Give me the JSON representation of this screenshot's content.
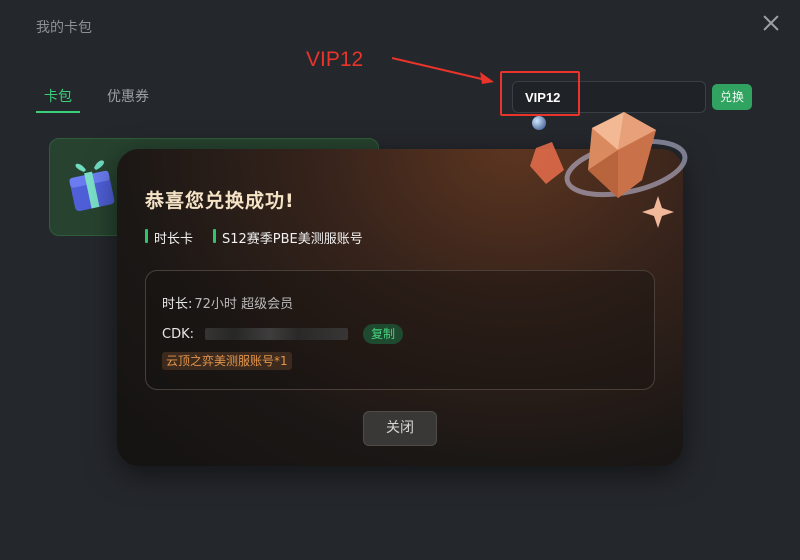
{
  "window": {
    "title": "我的卡包"
  },
  "annotation": {
    "label": "VIP12"
  },
  "tabs": [
    {
      "label": "卡包",
      "active": true
    },
    {
      "label": "优惠券",
      "active": false
    }
  ],
  "redeem": {
    "code_value": "VIP12",
    "button_label": "兑换"
  },
  "dialog": {
    "title": "恭喜您兑换成功!",
    "tags": [
      "时长卡",
      "S12赛季PBE美测服账号"
    ],
    "duration": {
      "label": "时长:",
      "value": "72小时 超级会员"
    },
    "cdk": {
      "label": "CDK:",
      "copy_label": "复制"
    },
    "reward_badge": "云顶之弈美测服账号*1",
    "close_label": "关闭"
  },
  "colors": {
    "accent_green": "#3ccf7a",
    "annotation_red": "#e8342a",
    "title_gold": "#f5e3c6",
    "badge_orange": "#e3954b"
  },
  "icons": [
    "close-icon",
    "gift-icon",
    "diamond-gem-icon",
    "sparkle-icon"
  ]
}
